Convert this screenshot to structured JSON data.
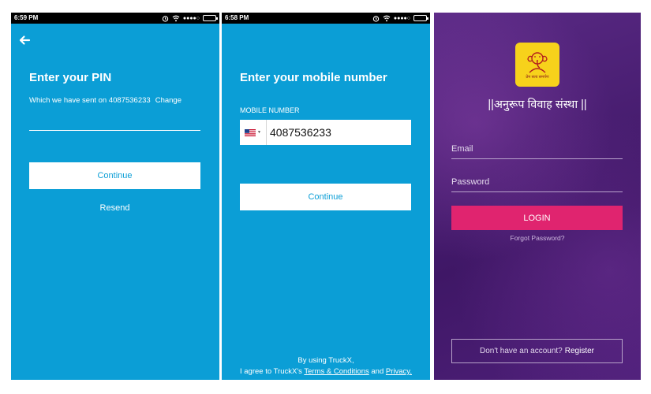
{
  "screen1": {
    "status_time": "6:59 PM",
    "title": "Enter your PIN",
    "subtitle": "Which we have sent on 4087536233",
    "change_label": "Change",
    "continue_label": "Continue",
    "resend_label": "Resend"
  },
  "screen2": {
    "status_time": "6:58 PM",
    "title": "Enter your mobile number",
    "field_label": "MOBILE NUMBER",
    "phone_value": "4087536233",
    "continue_label": "Continue",
    "legal_line1": "By using TruckX,",
    "legal_prefix": "I agree to TruckX's",
    "terms_label": "Terms & Conditions",
    "and_text": "and",
    "privacy_label": "Privacy."
  },
  "screen3": {
    "logo_caption": "प्रेम सत्य समर्पण",
    "brand_name": "||अनुरूप विवाह  संस्था ||",
    "email_placeholder": "Email",
    "password_placeholder": "Password",
    "login_label": "LOGIN",
    "forgot_label": "Forgot Password?",
    "no_account_text": "Don't have an account?",
    "register_label": "Register"
  },
  "colors": {
    "blue_bg": "#0b9ed6",
    "purple_bg": "#4a1f72",
    "login_pink": "#e0246f",
    "logo_yellow": "#f7d21b"
  },
  "icons": [
    "back-arrow-icon",
    "alarm-icon",
    "wifi-icon",
    "signal-icon",
    "battery-icon",
    "us-flag-icon",
    "ganesha-logo-icon"
  ]
}
